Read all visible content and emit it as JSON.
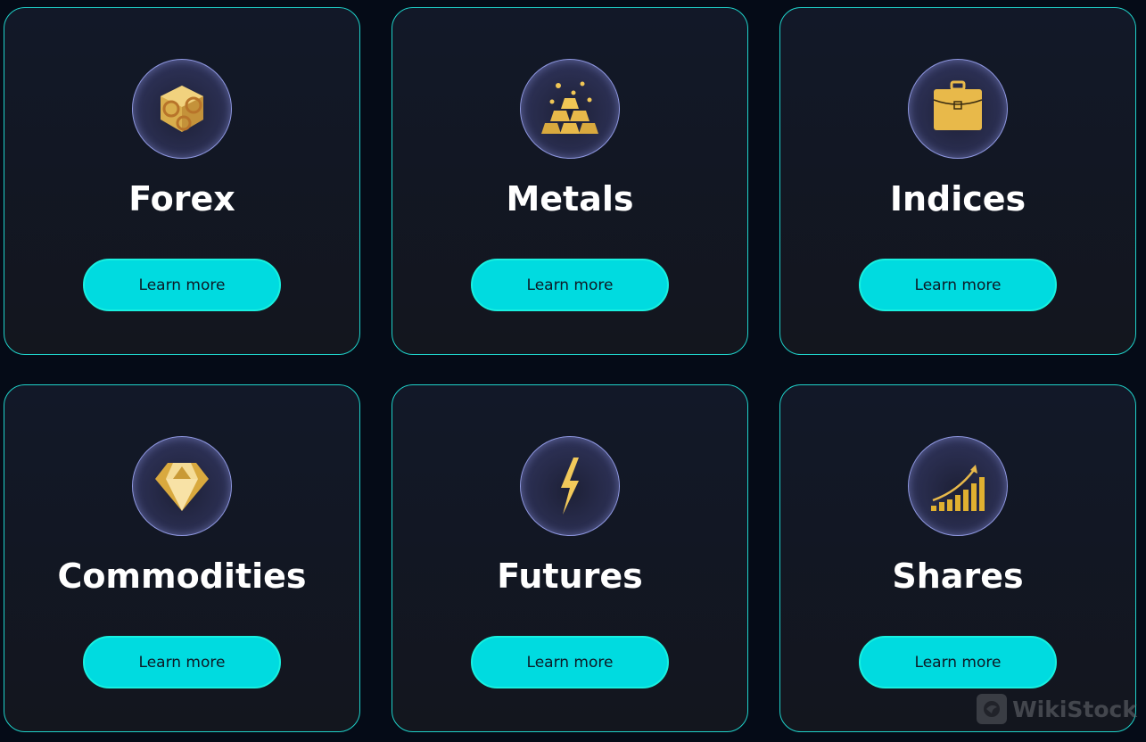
{
  "cards": [
    {
      "title": "Forex",
      "icon": "currency-cube-icon",
      "button_label": "Learn more"
    },
    {
      "title": "Metals",
      "icon": "gold-bars-icon",
      "button_label": "Learn more"
    },
    {
      "title": "Indices",
      "icon": "briefcase-icon",
      "button_label": "Learn more"
    },
    {
      "title": "Commodities",
      "icon": "diamond-icon",
      "button_label": "Learn more"
    },
    {
      "title": "Futures",
      "icon": "lightning-icon",
      "button_label": "Learn more"
    },
    {
      "title": "Shares",
      "icon": "growth-chart-icon",
      "button_label": "Learn more"
    }
  ],
  "watermark": {
    "text": "WikiStock"
  },
  "colors": {
    "accent": "#00dbe0",
    "border": "#1fd1c9",
    "background": "#050b17",
    "card": "#121828",
    "gold": "#e8b94a"
  }
}
